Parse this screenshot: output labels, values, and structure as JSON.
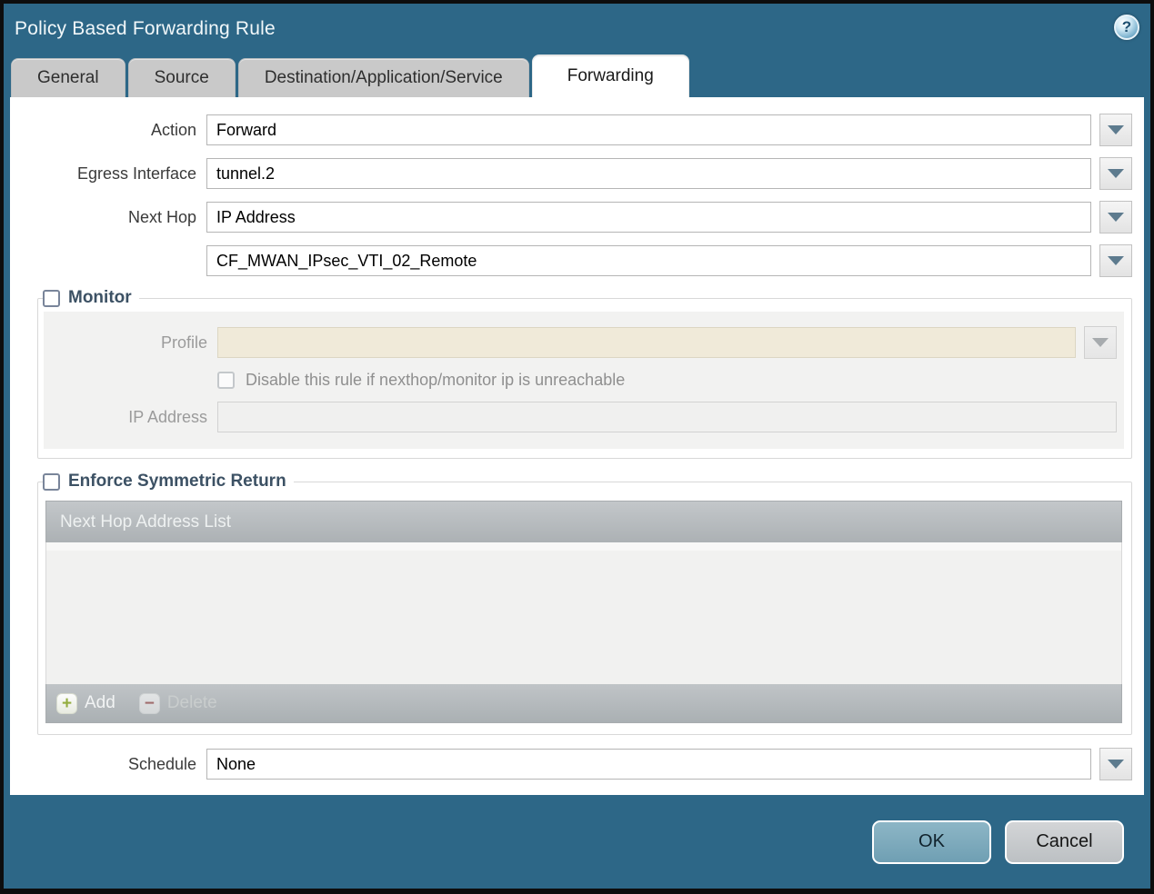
{
  "window": {
    "title": "Policy Based Forwarding Rule"
  },
  "icons": {
    "help_glyph": "?",
    "dropdown": "triangle-down",
    "add_glyph": "+",
    "delete_glyph": "−"
  },
  "tabs": [
    {
      "label": "General",
      "active": false
    },
    {
      "label": "Source",
      "active": false
    },
    {
      "label": "Destination/Application/Service",
      "active": false
    },
    {
      "label": "Forwarding",
      "active": true
    }
  ],
  "form": {
    "action": {
      "label": "Action",
      "value": "Forward"
    },
    "egress_interface": {
      "label": "Egress Interface",
      "value": "tunnel.2"
    },
    "next_hop": {
      "label": "Next Hop",
      "value": "IP Address"
    },
    "next_hop_address": {
      "value": "CF_MWAN_IPsec_VTI_02_Remote"
    },
    "schedule": {
      "label": "Schedule",
      "value": "None"
    }
  },
  "monitor": {
    "legend": "Monitor",
    "checked": false,
    "profile_label": "Profile",
    "profile_value": "",
    "disable_checkbox_label": "Disable this rule if nexthop/monitor ip is unreachable",
    "disable_checkbox_checked": false,
    "ip_address_label": "IP Address",
    "ip_address_value": ""
  },
  "symmetric_return": {
    "legend": "Enforce Symmetric Return",
    "checked": false,
    "table_header": "Next Hop Address List",
    "rows": [],
    "add_label": "Add",
    "delete_label": "Delete"
  },
  "footer": {
    "ok_label": "OK",
    "cancel_label": "Cancel"
  },
  "colors": {
    "teal_background": "#2d6787",
    "active_tab": "#ffffff",
    "inactive_tab": "#c9c9c9",
    "disabled_field_beige": "#f0ead9",
    "panel_grey": "#f2f2f1",
    "table_bar_grey": "#b3b7ba",
    "ok_button": "#7aa9bc",
    "cancel_button": "#c6c9cc",
    "legend_text": "#3c5164",
    "dropdown_arrow": "#5d7b8e"
  }
}
